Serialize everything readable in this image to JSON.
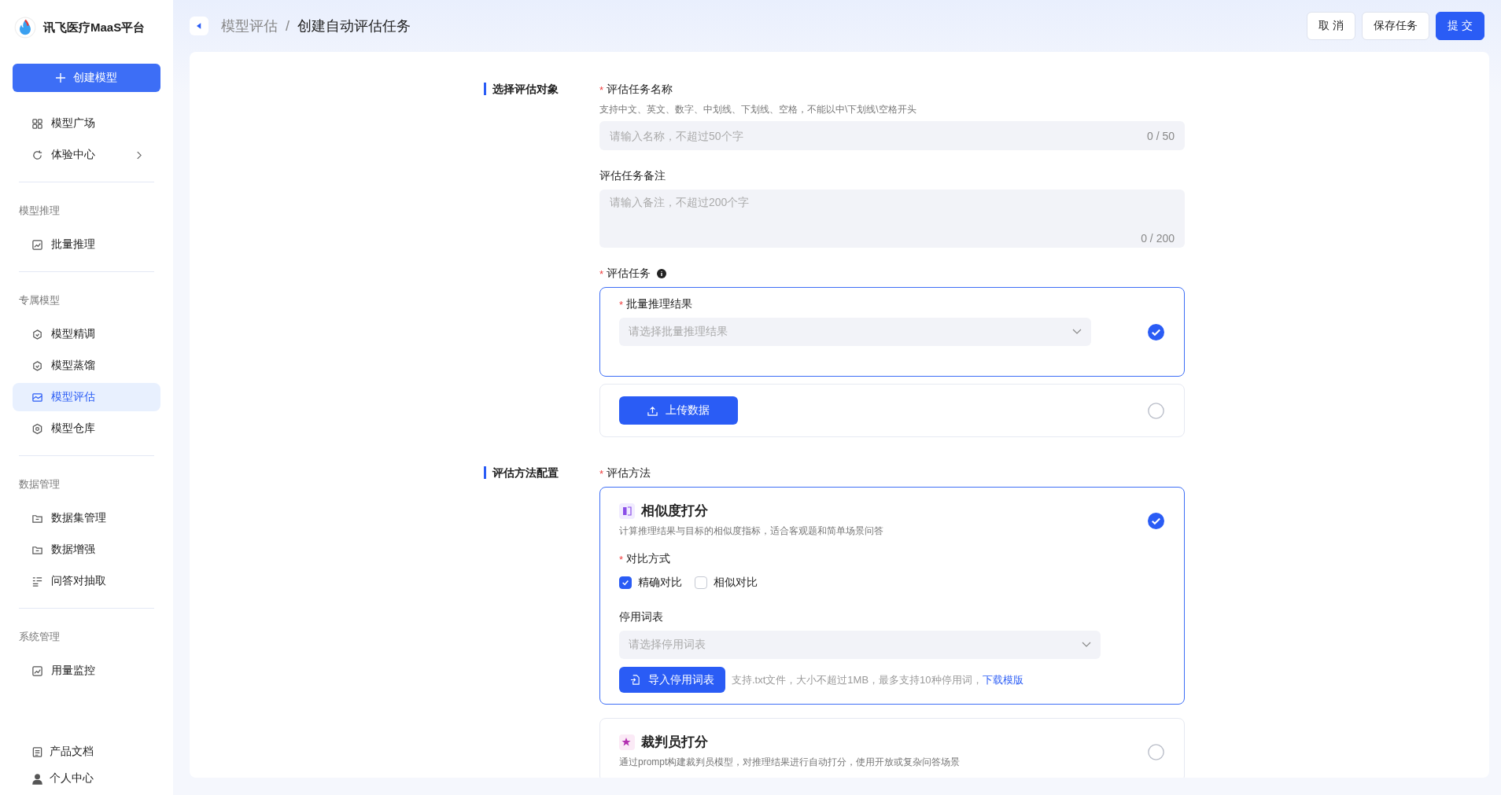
{
  "brand": {
    "name": "讯飞医疗MaaS平台"
  },
  "required_mark": "*",
  "sidebar": {
    "create_button": "创建模型",
    "top_items": [
      {
        "label": "模型广场",
        "selected": false,
        "expandable": false
      },
      {
        "label": "体验中心",
        "selected": false,
        "expandable": true
      }
    ],
    "groups": [
      {
        "title": "模型推理",
        "items": [
          {
            "label": "批量推理",
            "selected": false
          }
        ]
      },
      {
        "title": "专属模型",
        "items": [
          {
            "label": "模型精调",
            "selected": false
          },
          {
            "label": "模型蒸馏",
            "selected": false
          },
          {
            "label": "模型评估",
            "selected": true
          },
          {
            "label": "模型仓库",
            "selected": false
          }
        ]
      },
      {
        "title": "数据管理",
        "items": [
          {
            "label": "数据集管理",
            "selected": false
          },
          {
            "label": "数据增强",
            "selected": false
          },
          {
            "label": "问答对抽取",
            "selected": false
          }
        ]
      },
      {
        "title": "系统管理",
        "items": [
          {
            "label": "用量监控",
            "selected": false
          }
        ]
      }
    ],
    "footer_items": [
      {
        "label": "产品文档"
      },
      {
        "label": "个人中心"
      }
    ]
  },
  "header": {
    "breadcrumb": [
      "模型评估",
      "创建自动评估任务"
    ],
    "breadcrumb_separator": "/",
    "buttons": [
      {
        "label": "取 消",
        "kind": "default"
      },
      {
        "label": "保存任务",
        "kind": "default"
      },
      {
        "label": "提 交",
        "kind": "primary"
      }
    ]
  },
  "sections": [
    {
      "title": "选择评估对象"
    },
    {
      "title": "评估方法配置"
    }
  ],
  "task_name": {
    "label": "评估任务名称",
    "required": true,
    "hint": "支持中文、英文、数字、中划线、下划线、空格，不能以中\\下划线\\空格开头",
    "placeholder": "请输入名称，不超过50个字",
    "count": "0 / 50"
  },
  "task_note": {
    "label": "评估任务备注",
    "required": false,
    "placeholder": "请输入备注，不超过200个字",
    "count": "0 / 200"
  },
  "eval_task": {
    "label": "评估任务",
    "required": true,
    "options": [
      {
        "kind": "select",
        "selected": true,
        "label": "批量推理结果",
        "required": true,
        "placeholder": "请选择批量推理结果"
      },
      {
        "kind": "upload",
        "selected": false,
        "button": "上传数据"
      }
    ]
  },
  "eval_method": {
    "label": "评估方法",
    "required": true,
    "methods": [
      {
        "kind": "similarity",
        "selected": true,
        "title": "相似度打分",
        "description": "计算推理结果与目标的相似度指标，适合客观题和简单场景问答",
        "compare": {
          "label": "对比方式",
          "required": true,
          "options": [
            {
              "label": "精确对比",
              "checked": true
            },
            {
              "label": "相似对比",
              "checked": false
            }
          ]
        },
        "stopwords": {
          "label": "停用词表",
          "placeholder": "请选择停用词表",
          "import_button": "导入停用词表",
          "note": "支持.txt文件，大小不超过1MB，最多支持10种停用词，",
          "link": "下载模版"
        }
      },
      {
        "kind": "judge",
        "selected": false,
        "title": "裁判员打分",
        "description": "通过prompt构建裁判员模型，对推理结果进行自动打分，使用开放或复杂问答场景"
      }
    ]
  }
}
